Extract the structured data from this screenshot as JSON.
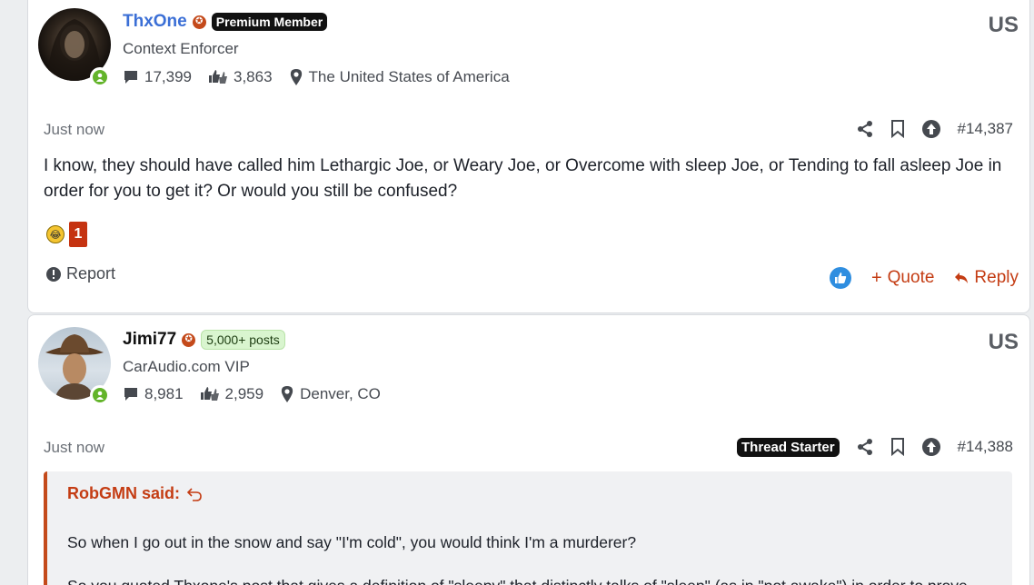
{
  "posts": [
    {
      "username": "ThxOne",
      "badge": "Premium Member",
      "user_title": "Context Enforcer",
      "messages": "17,399",
      "reactions": "3,863",
      "location": "The United States of America",
      "country_code": "US",
      "time": "Just now",
      "post_number": "#14,387",
      "body": "I know, they should have called him Lethargic Joe, or Weary Joe, or Overcome with sleep Joe, or Tending to fall asleep Joe in order for you to get it? Or would you still be confused?",
      "reaction_count": "1",
      "report_label": "Report",
      "quote_label": "Quote",
      "reply_label": "Reply"
    },
    {
      "username": "Jimi77",
      "badge": "5,000+ posts",
      "user_title": "CarAudio.com VIP",
      "messages": "8,981",
      "reactions": "2,959",
      "location": "Denver, CO",
      "country_code": "US",
      "time": "Just now",
      "thread_starter": "Thread Starter",
      "post_number": "#14,388",
      "quote_author": "RobGMN said:",
      "quote_line1": "So when I go out in the snow and say \"I'm cold\", you would think I'm a murderer?",
      "quote_line2": "So you quoted Thxone's post that gives a definition of \"sleepy\" that distinctly talks of \"sleep\" (as in \"not awake\") in order to prove"
    }
  ],
  "colors": {
    "accent": "#c44a1b",
    "link_blue": "#3b6fd6",
    "online": "#63b42a"
  }
}
